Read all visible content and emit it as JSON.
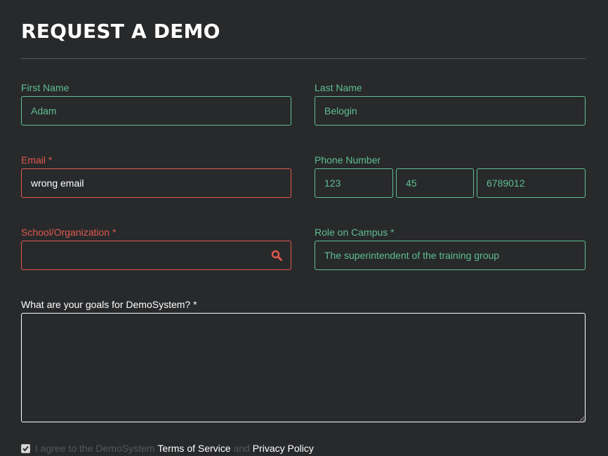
{
  "form": {
    "title": "REQUEST A DEMO",
    "first_name": {
      "label": "First Name",
      "value": "Adam"
    },
    "last_name": {
      "label": "Last Name",
      "value": "Belogin"
    },
    "email": {
      "label": "Email *",
      "value": "wrong email"
    },
    "phone": {
      "label": "Phone Number",
      "part1": "123",
      "part2": "45",
      "part3": "6789012"
    },
    "school": {
      "label": "School/Organization *",
      "value": ""
    },
    "role": {
      "label": "Role on Campus *",
      "value": "The superintendent of the training group"
    },
    "goals": {
      "label": "What are your goals for DemoSystem? *",
      "value": ""
    },
    "agree": {
      "checked": true,
      "prefix": "I agree to the DemoSystem ",
      "terms_link": "Terms of Service",
      "conjunction": " and ",
      "privacy_link": "Privacy Policy"
    }
  },
  "icons": {
    "school_search": "search-icon",
    "agree_check": "checkmark-icon"
  },
  "colors": {
    "valid": "#5fbf92",
    "error": "#e05a4e",
    "background": "#28292b"
  }
}
